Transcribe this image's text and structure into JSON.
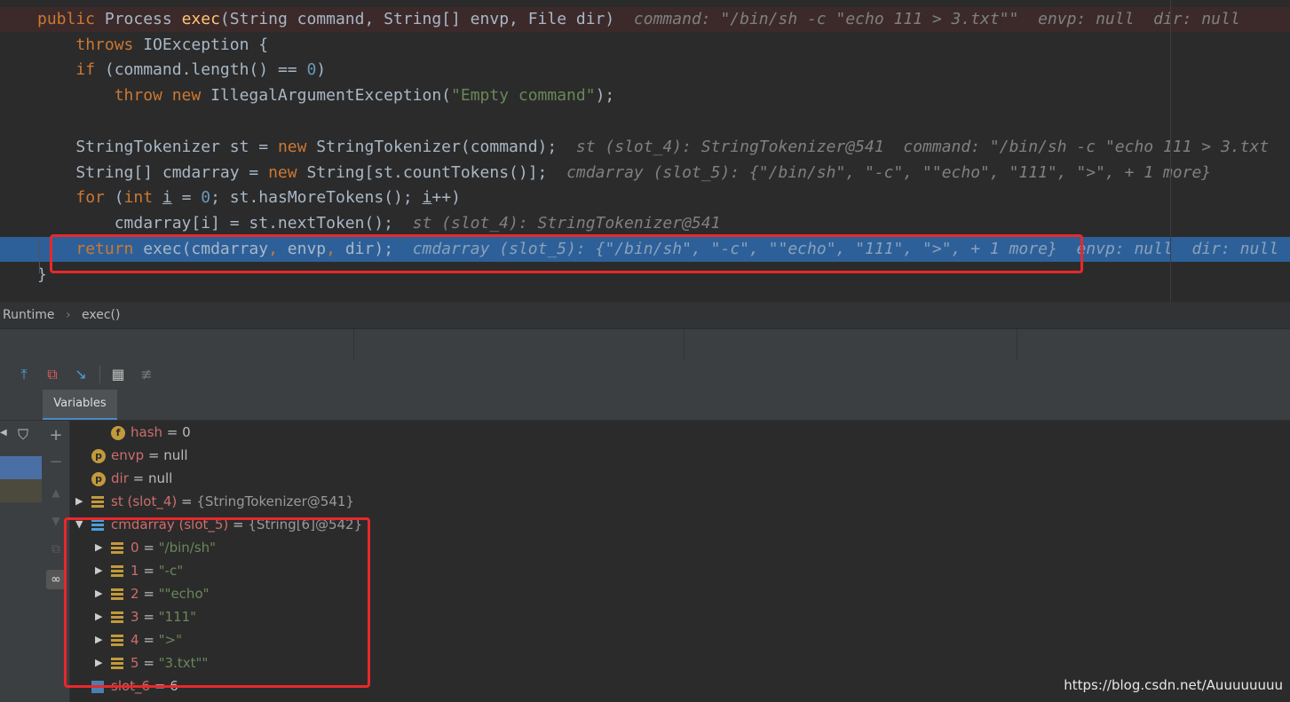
{
  "editor": {
    "lines": [
      {
        "segments": [
          [
            "kw",
            "public "
          ],
          [
            "",
            "Process "
          ],
          [
            "fn",
            "exec"
          ],
          [
            "",
            "(String command, String[] envp, File dir)"
          ],
          [
            "cm",
            "  command: \"/bin/sh -c \"echo 111 > 3.txt\"\"  envp: null  dir: null"
          ]
        ]
      },
      {
        "segments": [
          [
            "",
            "    "
          ],
          [
            "kw",
            "throws "
          ],
          [
            "",
            "IOException {"
          ]
        ]
      },
      {
        "segments": [
          [
            "",
            "    "
          ],
          [
            "kw",
            "if "
          ],
          [
            "",
            "(command.length() == "
          ],
          [
            "num",
            "0"
          ],
          [
            "",
            ")"
          ]
        ]
      },
      {
        "segments": [
          [
            "",
            "        "
          ],
          [
            "kw",
            "throw new "
          ],
          [
            "",
            "IllegalArgumentException("
          ],
          [
            "str",
            "\"Empty command\""
          ],
          [
            "",
            ");"
          ]
        ]
      },
      {
        "segments": [
          [
            "",
            ""
          ]
        ]
      },
      {
        "segments": [
          [
            "",
            "    StringTokenizer st = "
          ],
          [
            "kw",
            "new "
          ],
          [
            "",
            "StringTokenizer(command);"
          ],
          [
            "cm",
            "  st (slot_4): StringTokenizer@541  command: \"/bin/sh -c \"echo 111 > 3.txt"
          ]
        ]
      },
      {
        "segments": [
          [
            "",
            "    String[] cmdarray = "
          ],
          [
            "kw",
            "new "
          ],
          [
            "",
            "String[st.countTokens()];"
          ],
          [
            "cm",
            "  cmdarray (slot_5): {\"/bin/sh\", \"-c\", \"\"echo\", \"111\", \">\", + 1 more}"
          ]
        ]
      },
      {
        "segments": [
          [
            "",
            "    "
          ],
          [
            "kw",
            "for "
          ],
          [
            "",
            "("
          ],
          [
            "kw",
            "int "
          ],
          [
            "ul",
            "i"
          ],
          [
            "",
            " = "
          ],
          [
            "num",
            "0"
          ],
          [
            "",
            "; st.hasMoreTokens(); "
          ],
          [
            "ul",
            "i"
          ],
          [
            "",
            "++)"
          ]
        ]
      },
      {
        "segments": [
          [
            "",
            "        cmdarray[i] = st.nextToken();"
          ],
          [
            "cm",
            "  st (slot_4): StringTokenizer@541"
          ]
        ]
      },
      {
        "segments": [
          [
            "",
            "    "
          ],
          [
            "kw",
            "return "
          ],
          [
            "",
            "exec(cmdarray"
          ],
          [
            "kw",
            ", "
          ],
          [
            "",
            "envp"
          ],
          [
            "kw",
            ", "
          ],
          [
            "",
            "dir);"
          ],
          [
            "cm",
            "  cmdarray (slot_5): {\"/bin/sh\", \"-c\", \"\"echo\", \"111\", \">\", + 1 more}  envp: null  dir: null"
          ]
        ]
      },
      {
        "segments": [
          [
            "",
            "}"
          ]
        ]
      }
    ]
  },
  "breadcrumb": {
    "items": [
      "Runtime",
      "exec()"
    ],
    "separator": "›"
  },
  "panel": {
    "tab_label": "Variables"
  },
  "toolbar_icons": [
    "step-out-icon",
    "drop-frame-icon",
    "run-to-cursor-icon",
    "evaluate-expression-icon",
    "trace-stream-icon"
  ],
  "variables": [
    {
      "indent": 1,
      "badge": "f",
      "name": "hash",
      "eq": " = ",
      "value": "0",
      "kind": "plain"
    },
    {
      "indent": 0,
      "badge": "p",
      "name": "envp",
      "eq": " = ",
      "value": "null",
      "kind": "plain"
    },
    {
      "indent": 0,
      "badge": "p",
      "name": "dir",
      "eq": " = ",
      "value": "null",
      "kind": "plain"
    },
    {
      "indent": 0,
      "badge": "stack",
      "name": "st (slot_4)",
      "eq": " = ",
      "value": "{StringTokenizer@541}",
      "kind": "ref",
      "arrow": "▶"
    },
    {
      "indent": 0,
      "badge": "array",
      "name": "cmdarray (slot_5)",
      "eq": " = ",
      "value": "{String[6]@542}",
      "kind": "ref",
      "arrow": "▼"
    },
    {
      "indent": 1,
      "badge": "stack",
      "name": "0",
      "eq": " = ",
      "value": "\"/bin/sh\"",
      "kind": "str",
      "arrow": "▶"
    },
    {
      "indent": 1,
      "badge": "stack",
      "name": "1",
      "eq": " = ",
      "value": "\"-c\"",
      "kind": "str",
      "arrow": "▶"
    },
    {
      "indent": 1,
      "badge": "stack",
      "name": "2",
      "eq": " = ",
      "value": "\"\"echo\"",
      "kind": "str",
      "arrow": "▶"
    },
    {
      "indent": 1,
      "badge": "stack",
      "name": "3",
      "eq": " = ",
      "value": "\"111\"",
      "kind": "str",
      "arrow": "▶"
    },
    {
      "indent": 1,
      "badge": "stack",
      "name": "4",
      "eq": " = ",
      "value": "\">\"",
      "kind": "str",
      "arrow": "▶"
    },
    {
      "indent": 1,
      "badge": "stack",
      "name": "5",
      "eq": " = ",
      "value": "\"3.txt\"\"",
      "kind": "str",
      "arrow": "▶"
    },
    {
      "indent": 0,
      "badge": "int",
      "name": "slot_6",
      "eq": " = ",
      "value": "6",
      "kind": "plain"
    }
  ],
  "watermark": "https://blog.csdn.net/Auuuuuuuu",
  "colors": {
    "highlight": "#2d6099",
    "redbox": "#e8282b",
    "keyword": "#cc7832",
    "string": "#6a8759"
  }
}
